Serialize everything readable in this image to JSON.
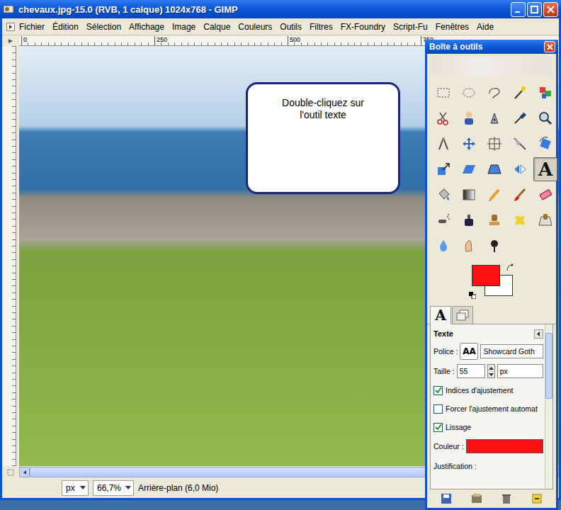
{
  "window": {
    "title": "chevaux.jpg-15.0 (RVB, 1 calque) 1024x768 - GIMP"
  },
  "menu": [
    "Fichier",
    "Édition",
    "Sélection",
    "Affichage",
    "Image",
    "Calque",
    "Couleurs",
    "Outils",
    "Filtres",
    "FX-Foundry",
    "Script-Fu",
    "Fenêtres",
    "Aide"
  ],
  "ruler": {
    "marks": [
      "0",
      "250",
      "500",
      "750"
    ]
  },
  "canvas": {
    "callout": "Double-cliquez sur l'outil texte",
    "h_scroll": {
      "level": 0.97
    }
  },
  "status_bar": {
    "unit": "px",
    "zoom": "66,7%",
    "layer": "Arrière-plan (6,0 Mio)"
  },
  "toolbox": {
    "title": "Boîte à outils",
    "tools": [
      {
        "selected": false
      },
      {
        "selected": false
      },
      {
        "selected": false
      },
      {
        "selected": false
      },
      {
        "selected": false
      },
      {
        "selected": false
      },
      {
        "selected": false
      },
      {
        "selected": false
      },
      {
        "selected": false
      },
      {
        "selected": false
      },
      {
        "selected": false
      },
      {
        "selected": false
      },
      {
        "selected": false
      },
      {
        "selected": false
      },
      {
        "selected": false
      },
      {
        "selected": false
      },
      {
        "selected": false
      },
      {
        "selected": false
      },
      {
        "selected": false
      },
      {
        "glyph": "A",
        "selected": true
      },
      {
        "selected": false
      },
      {
        "selected": false
      },
      {
        "selected": false
      },
      {
        "selected": false
      },
      {
        "selected": false
      },
      {
        "selected": false
      },
      {
        "selected": false
      },
      {
        "selected": false
      },
      {
        "selected": false
      },
      {
        "selected": false
      },
      {
        "selected": false
      },
      {
        "selected": false
      },
      {
        "selected": false
      }
    ],
    "foreground_color": "#ff1010",
    "background_color": "#ffffff",
    "tabs": [
      {
        "glyph": "A",
        "selected": true
      },
      {
        "selected": false
      }
    ],
    "options": {
      "title": "Texte",
      "font_label": "Police :",
      "font_preview": "AA",
      "font": "Showcard Goth",
      "size_label": "Taille :",
      "size": "55",
      "unit": "px",
      "checks": [
        {
          "label": "Indices d'ajustement",
          "checked": true
        },
        {
          "label": "Forcer l'ajustement automat",
          "checked": false
        },
        {
          "label": "Lissage",
          "checked": true
        }
      ],
      "color_label": "Couleur :",
      "color": "#ff1010",
      "justification_label": "Justification :",
      "scroll": {
        "level": 0.4
      }
    }
  }
}
